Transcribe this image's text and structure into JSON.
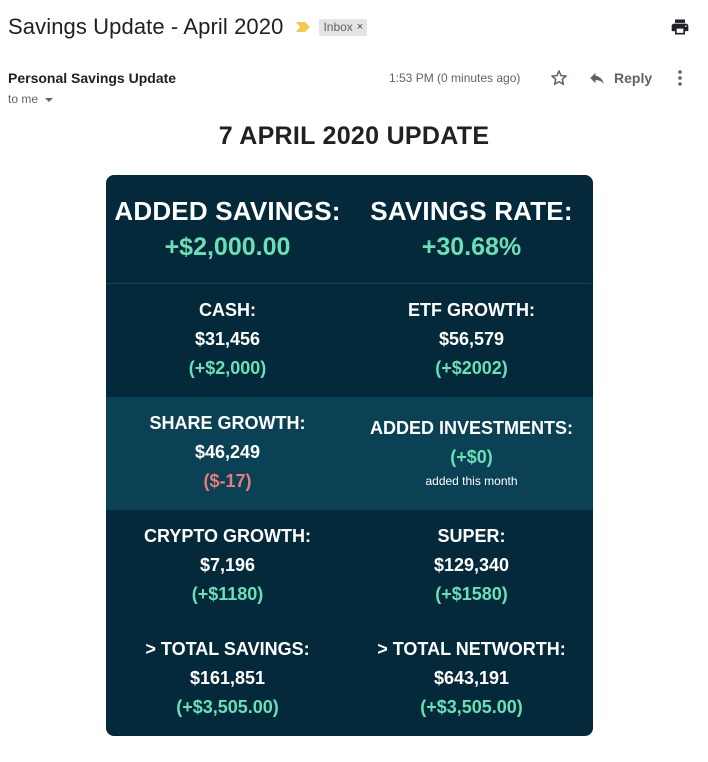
{
  "email": {
    "subject": "Savings Update - April 2020",
    "label_chip": "Inbox",
    "label_chip_close": "×",
    "sender": "Personal Savings Update",
    "time": "1:53 PM (0 minutes ago)",
    "reply_label": "Reply",
    "recipient": "to me",
    "icons": [
      "importance-marker-icon",
      "printer-icon",
      "star-icon",
      "reply-arrow-icon",
      "more-vertical-icon",
      "chevron-down-icon"
    ]
  },
  "report": {
    "title": "7 APRIL 2020 UPDATE",
    "added_savings": {
      "label": "ADDED SAVINGS:",
      "value": "+$2,000.00"
    },
    "savings_rate": {
      "label": "SAVINGS RATE:",
      "value": "+30.68%"
    },
    "cash": {
      "label": "CASH:",
      "value": "$31,456",
      "change": "(+$2,000)"
    },
    "etf_growth": {
      "label": "ETF GROWTH:",
      "value": "$56,579",
      "change": "(+$2002)"
    },
    "share_growth": {
      "label": "SHARE GROWTH:",
      "value": "$46,249",
      "change": "($-17)"
    },
    "added_investments": {
      "label": "ADDED INVESTMENTS:",
      "change": "(+$0)",
      "note": "added this month"
    },
    "crypto_growth": {
      "label": "CRYPTO GROWTH:",
      "value": "$7,196",
      "change": "(+$1180)"
    },
    "super": {
      "label": "SUPER:",
      "value": "$129,340",
      "change": "(+$1580)"
    },
    "total_savings": {
      "label": "> TOTAL SAVINGS:",
      "value": "$161,851",
      "change": "(+$3,505.00)"
    },
    "total_networth": {
      "label": "> TOTAL NETWORTH:",
      "value": "$643,191",
      "change": "(+$3,505.00)"
    }
  },
  "colors": {
    "card_bg": "#04293a",
    "highlight_band": "#0b4155",
    "positive": "#6ae0b5",
    "negative": "#ea7b7b",
    "importance_marker": "#f2c94c"
  }
}
